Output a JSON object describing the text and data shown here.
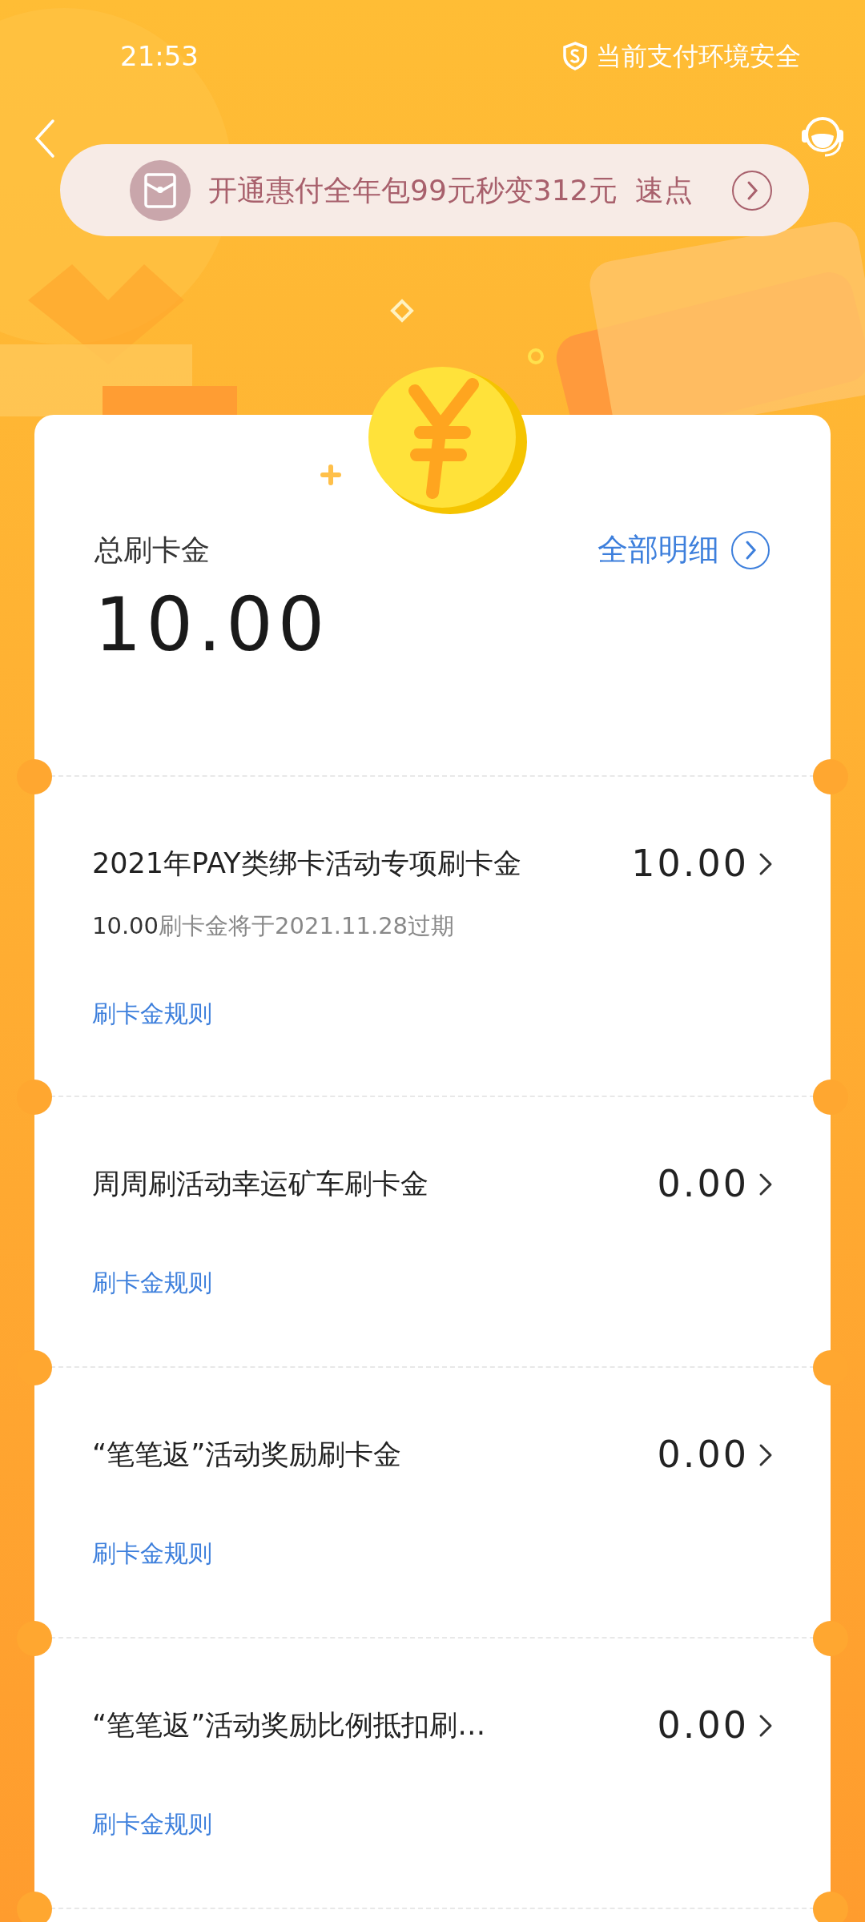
{
  "status_bar": {
    "time": "21:53",
    "security": "当前支付环境安全"
  },
  "banner": {
    "text": "开通惠付全年包99元秒变312元  速点"
  },
  "summary": {
    "label": "总刷卡金",
    "amount": "10.00",
    "details_link": "全部明细"
  },
  "items": [
    {
      "title": "2021年PAY类绑卡活动专项刷卡金",
      "amount": "10.00",
      "subtitle": {
        "amount": "10.00",
        "text": "刷卡金将于2021.11.28过期"
      },
      "rule_link": "刷卡金规则"
    },
    {
      "title": "周周刷活动幸运矿车刷卡金",
      "amount": "0.00",
      "rule_link": "刷卡金规则"
    },
    {
      "title": "“笔笔返”活动奖励刷卡金",
      "amount": "0.00",
      "rule_link": "刷卡金规则"
    },
    {
      "title": "“笔笔返”活动奖励比例抵扣刷…",
      "amount": "0.00",
      "rule_link": "刷卡金规则"
    }
  ]
}
